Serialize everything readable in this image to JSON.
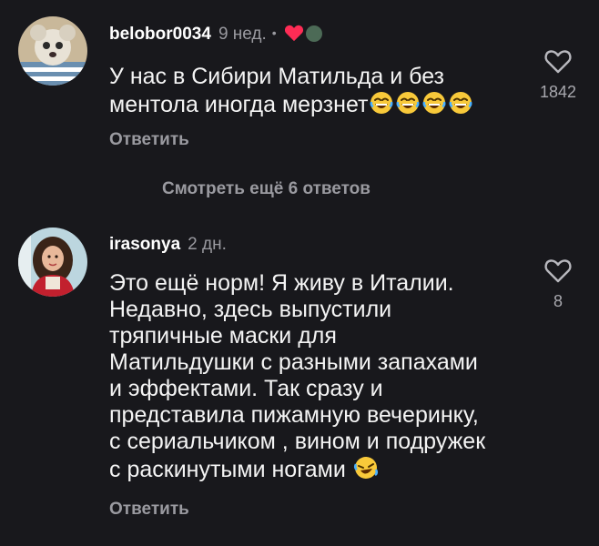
{
  "comments": [
    {
      "username": "belobor0034",
      "time": "9 нед.",
      "dot": "•",
      "text": "У нас в Сибири  Матильда и без ментола иногда мерзнет",
      "emoji_count": 4,
      "emoji": "😂",
      "like_count": "1842",
      "reply_label": "Ответить",
      "liked_by_creator": true
    },
    {
      "username": "irasonya",
      "time": "2 дн.",
      "text_lines": [
        "Это ещё норм! Я живу в Италии.",
        "Недавно, здесь выпустили",
        "тряпичные маски для",
        "Матильдушки с разными запахами",
        "и эффектами. Так сразу и",
        "представила пижамную вечеринку,",
        "с сериальчиком , вином и подружек",
        "с раскинутыми ногами"
      ],
      "emoji": "🤣",
      "like_count": "8",
      "reply_label": "Ответить"
    }
  ],
  "more_replies_label": "Смотреть ещё 6 ответов",
  "colors": {
    "background": "#18181c",
    "secondary_text": "#9a9aa0",
    "heart_red": "#fe2c55"
  }
}
